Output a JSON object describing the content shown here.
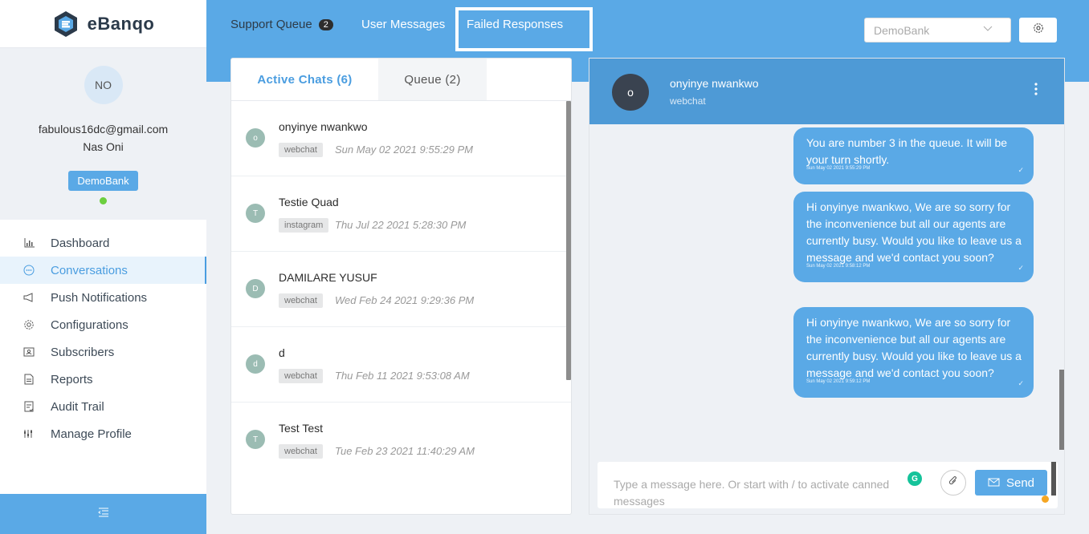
{
  "brand": {
    "name": "eBanqo"
  },
  "profile": {
    "initials": "NO",
    "email": "fabulous16dc@gmail.com",
    "name": "Nas Oni",
    "bank": "DemoBank",
    "status_color": "#6ccf3f"
  },
  "nav": [
    {
      "label": "Dashboard",
      "icon": "bar-chart-icon"
    },
    {
      "label": "Conversations",
      "icon": "chat-bubble-icon",
      "active": true
    },
    {
      "label": "Push Notifications",
      "icon": "megaphone-icon"
    },
    {
      "label": "Configurations",
      "icon": "gear-icon"
    },
    {
      "label": "Subscribers",
      "icon": "contact-card-icon"
    },
    {
      "label": "Reports",
      "icon": "document-icon"
    },
    {
      "label": "Audit Trail",
      "icon": "checklist-icon"
    },
    {
      "label": "Manage Profile",
      "icon": "sliders-icon"
    }
  ],
  "topbar": {
    "support_queue_label": "Support Queue",
    "support_queue_count": "2",
    "user_messages_label": "User Messages",
    "failed_responses_label": "Failed Responses",
    "bank_select_value": "DemoBank"
  },
  "list": {
    "active_tab": "Active Chats (6)",
    "queue_tab": "Queue (2)",
    "chats": [
      {
        "initial": "o",
        "name": "onyinye nwankwo",
        "channel": "webchat",
        "time": "Sun May 02 2021 9:55:29 PM"
      },
      {
        "initial": "T",
        "name": "Testie Quad",
        "channel": "instagram",
        "time": "Thu Jul 22 2021 5:28:30 PM"
      },
      {
        "initial": "D",
        "name": "DAMILARE YUSUF",
        "channel": "webchat",
        "time": "Wed Feb 24 2021 9:29:36 PM"
      },
      {
        "initial": "d",
        "name": "d",
        "channel": "webchat",
        "time": "Thu Feb 11 2021 9:53:08 AM"
      },
      {
        "initial": "T",
        "name": "Test Test",
        "channel": "webchat",
        "time": "Tue Feb 23 2021 11:40:29 AM"
      }
    ]
  },
  "conversation": {
    "initial": "o",
    "name": "onyinye nwankwo",
    "channel": "webchat",
    "messages": [
      {
        "text": "You are number 3 in the queue. It will be your turn shortly.",
        "time": "Sun May 02 2021 9:55:29 PM"
      },
      {
        "text": "Hi onyinye nwankwo, We are so sorry for the inconvenience but all our agents are currently busy. Would you like to leave us a message and we'd contact you soon?",
        "time": "Sun May 02 2021 9:58:12 PM"
      },
      {
        "text": "Hi onyinye nwankwo, We are so sorry for the inconvenience but all our agents are currently busy. Would you like to leave us a message and we'd contact you soon?",
        "time": "Sun May 02 2021 9:59:12 PM"
      }
    ],
    "composer_placeholder": "Type a message here. Or start with / to activate canned messages",
    "send_label": "Send"
  }
}
